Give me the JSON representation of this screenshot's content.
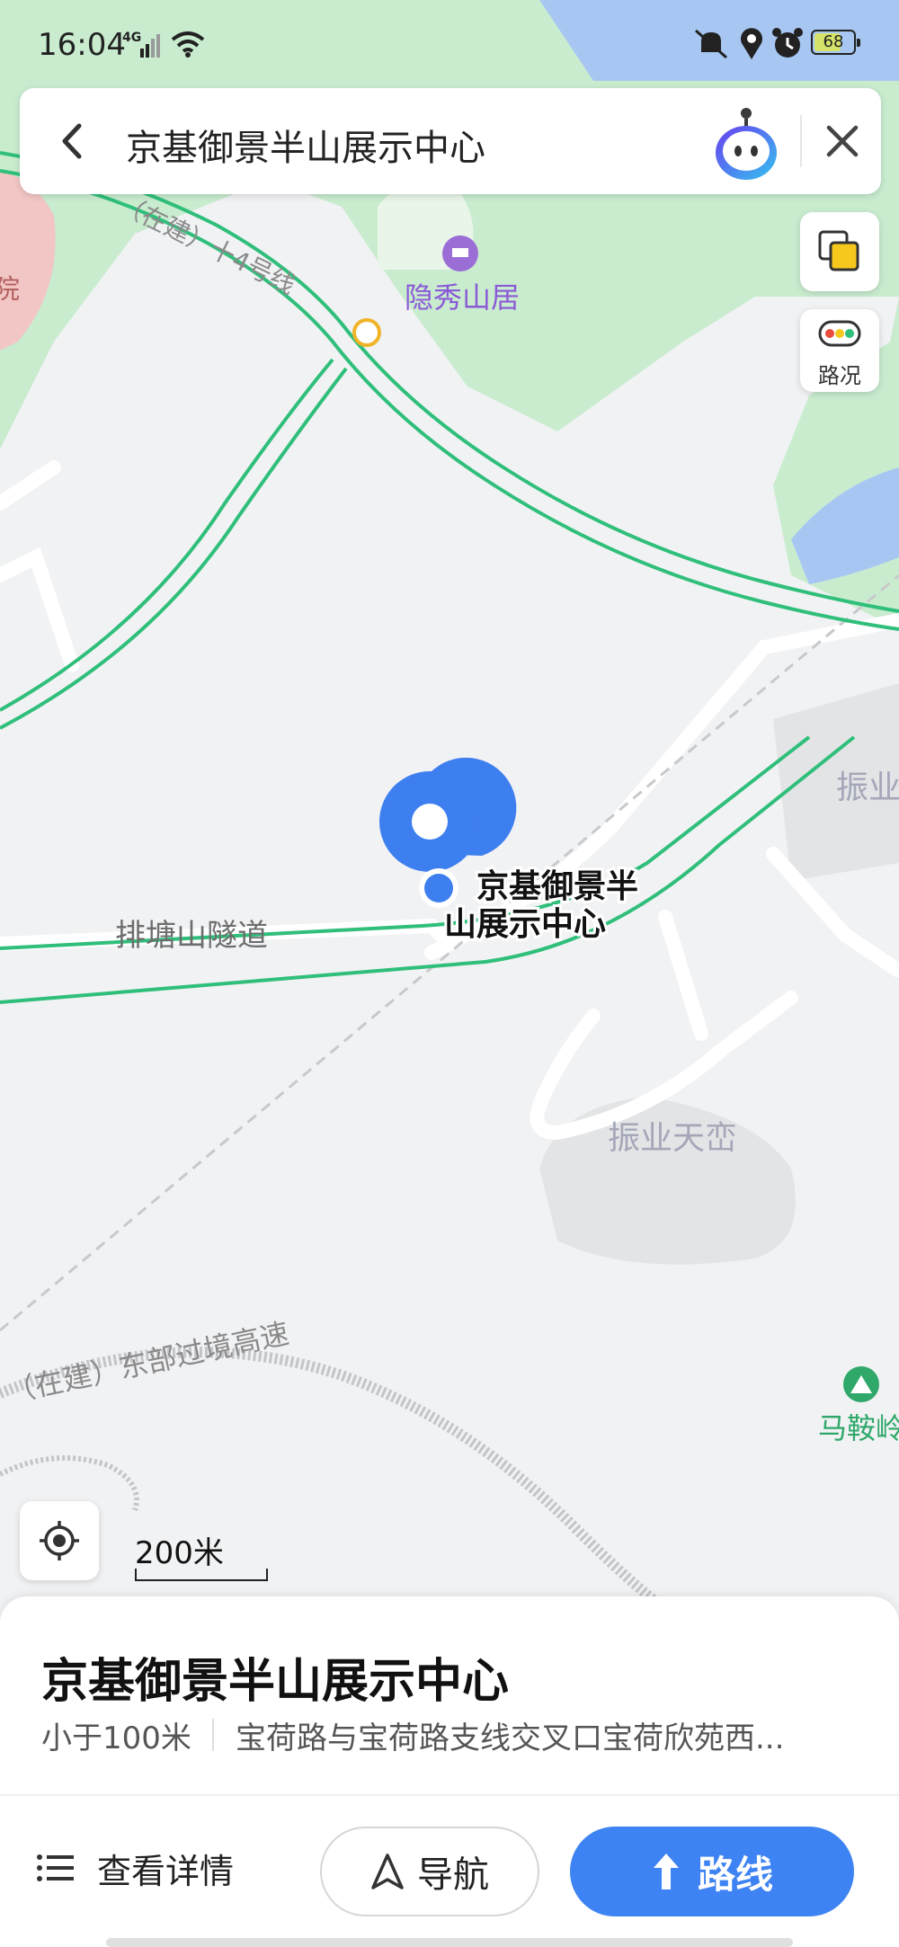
{
  "status_bar": {
    "time": "16:04",
    "network": "4G",
    "battery": "68",
    "battery_level": 0.68
  },
  "search": {
    "query": "京基御景半山展示中心"
  },
  "map_controls": {
    "traffic_label": "路况",
    "scale_label": "200米"
  },
  "map_labels": {
    "hotel": "隐秀山居",
    "metro_line": "（在建）十4号线",
    "tunnel": "排塘山隧道",
    "marker_line1": "京基御景半",
    "marker_line2": "山展示中心",
    "zhenye_edge": "振业",
    "zhenye_tianluan": "振业天峦",
    "expressway": "（在建）东部过境高速",
    "maanling": "马鞍岭",
    "left_edge": "院"
  },
  "place_card": {
    "title": "京基御景半山展示中心",
    "distance": "小于100米",
    "address": "宝荷路与宝荷路支线交叉口宝荷欣苑西...",
    "details_label": "查看详情",
    "navigate_label": "导航",
    "route_label": "路线"
  },
  "colors": {
    "accent": "#3e83f3",
    "road_outline": "#2fbf7a",
    "green_area": "#c9eccf",
    "water": "#a7c7f2"
  }
}
